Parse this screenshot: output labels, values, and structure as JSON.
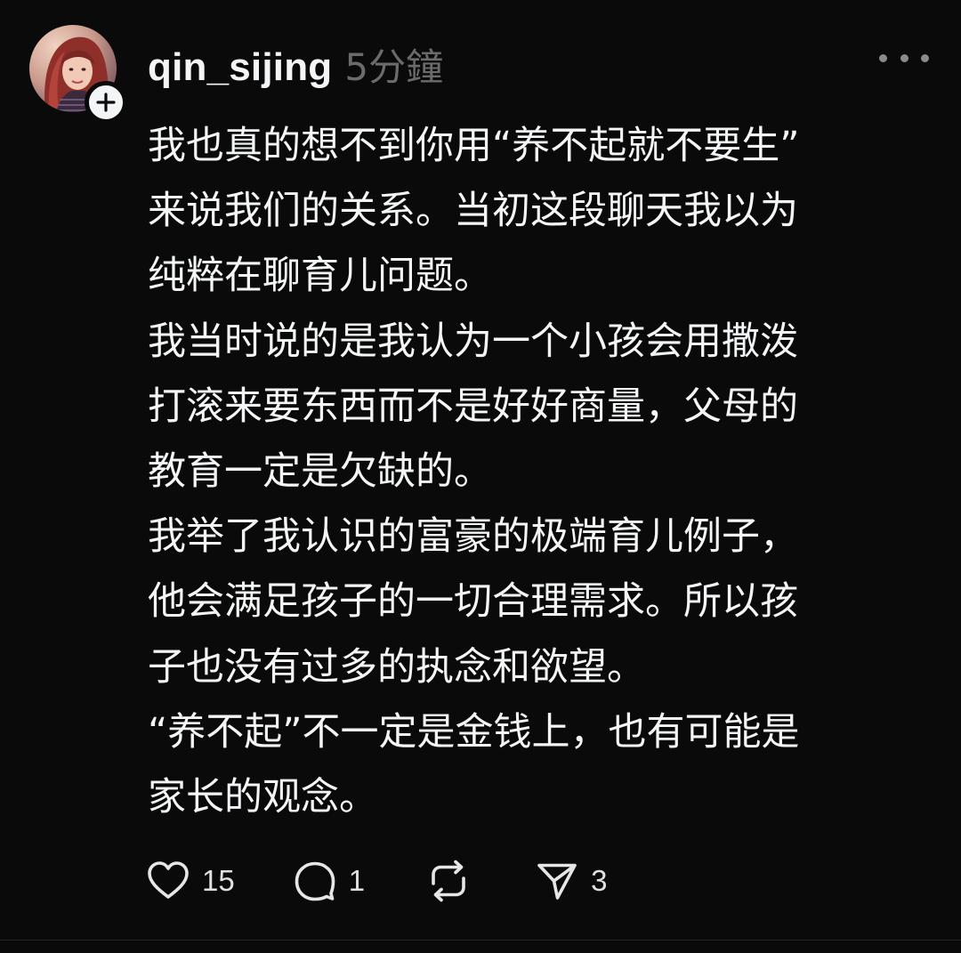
{
  "post": {
    "username": "qin_sijing",
    "timestamp": "5分鐘",
    "body_lines": [
      "我也真的想不到你用“养不起就不要生”",
      "来说我们的关系。当初这段聊天我以为",
      "纯粹在聊育儿问题。",
      "我当时说的是我认为一个小孩会用撒泼",
      "打滚来要东西而不是好好商量，父母的",
      "教育一定是欠缺的。",
      "我举了我认识的富豪的极端育儿例子，",
      "他会满足孩子的一切合理需求。所以孩",
      "子也没有过多的执念和欲望。",
      "“养不起”不一定是金钱上，也有可能是",
      "家长的观念。"
    ],
    "actions": {
      "likes": "15",
      "replies": "1",
      "shares": "3"
    }
  },
  "icons": {
    "like": "heart-icon",
    "reply": "comment-bubble-icon",
    "repost": "repost-icon",
    "share": "send-icon",
    "more": "more-dots-icon",
    "follow": "plus-icon"
  },
  "colors": {
    "background": "#0a0a0a",
    "text": "#f3f5f7",
    "muted": "#6b6b6b"
  }
}
